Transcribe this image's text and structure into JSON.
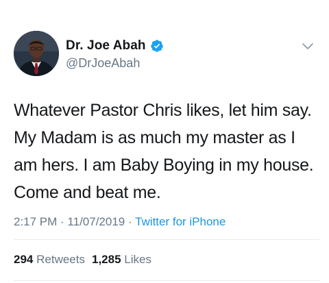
{
  "user": {
    "display_name": "Dr. Joe Abah",
    "handle": "@DrJoeAbah",
    "verified_icon": "verified-badge-icon",
    "avatar_icon": "profile-avatar"
  },
  "tweet": {
    "lines": [
      "Whatever Pastor Chris likes, let him say.",
      "My Madam is as much my master as I",
      "am hers. I am Baby Boying in my house.",
      "Come and beat me."
    ]
  },
  "meta": {
    "time": "2:17 PM",
    "separator": " · ",
    "date": "11/07/2019",
    "source": "Twitter for iPhone"
  },
  "stats": {
    "retweets_count": "294",
    "retweets_label": "Retweets",
    "likes_count": "1,285",
    "likes_label": "Likes"
  },
  "colors": {
    "text": "#14171a",
    "secondary": "#657786",
    "accent": "#1b95e0",
    "divider": "#e6ecf0"
  },
  "icons": {
    "menu": "chevron-down-icon"
  }
}
